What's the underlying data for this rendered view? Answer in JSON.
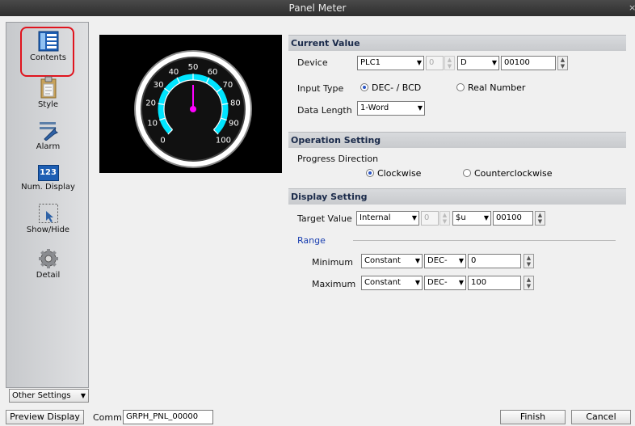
{
  "window": {
    "title": "Panel Meter",
    "close_glyph": "×"
  },
  "sidebar": {
    "items": [
      {
        "label": "Contents",
        "icon": "contents-icon"
      },
      {
        "label": "Style",
        "icon": "style-icon"
      },
      {
        "label": "Alarm",
        "icon": "alarm-icon"
      },
      {
        "label": "Num. Display",
        "icon": "num-display-icon",
        "icon_text": "123"
      },
      {
        "label": "Show/Hide",
        "icon": "show-hide-icon"
      },
      {
        "label": "Detail",
        "icon": "detail-icon"
      }
    ],
    "other_settings": "Other Settings"
  },
  "gauge": {
    "ticks": [
      "0",
      "10",
      "20",
      "30",
      "40",
      "50",
      "60",
      "70",
      "80",
      "90",
      "100"
    ],
    "value": 50,
    "min": 0,
    "max": 100
  },
  "current_value": {
    "header": "Current Value",
    "device_label": "Device",
    "device_plc": "PLC1",
    "device_station": "0",
    "device_type": "D",
    "device_address": "00100",
    "input_type_label": "Input Type",
    "input_dec": "DEC- / BCD",
    "input_real": "Real Number",
    "data_length_label": "Data Length",
    "data_length": "1-Word"
  },
  "operation": {
    "header": "Operation Setting",
    "progress_label": "Progress Direction",
    "clockwise": "Clockwise",
    "counterclockwise": "Counterclockwise"
  },
  "display": {
    "header": "Display Setting",
    "target_label": "Target Value",
    "target_source": "Internal",
    "target_station": "0",
    "target_type": "$u",
    "target_address": "00100",
    "range_label": "Range",
    "min_label": "Minimum",
    "min_source": "Constant",
    "min_format": "DEC-",
    "min_value": "0",
    "max_label": "Maximum",
    "max_source": "Constant",
    "max_format": "DEC-",
    "max_value": "100"
  },
  "footer": {
    "preview_display": "Preview Display",
    "comm_label": "Comm",
    "comm_value": "GRPH_PNL_00000",
    "finish": "Finish",
    "cancel": "Cancel"
  },
  "colors": {
    "accent_cyan": "#00e5ff",
    "needle": "#ff00ff",
    "selection_red": "#e0141e",
    "radio_blue": "#2a55c4"
  }
}
